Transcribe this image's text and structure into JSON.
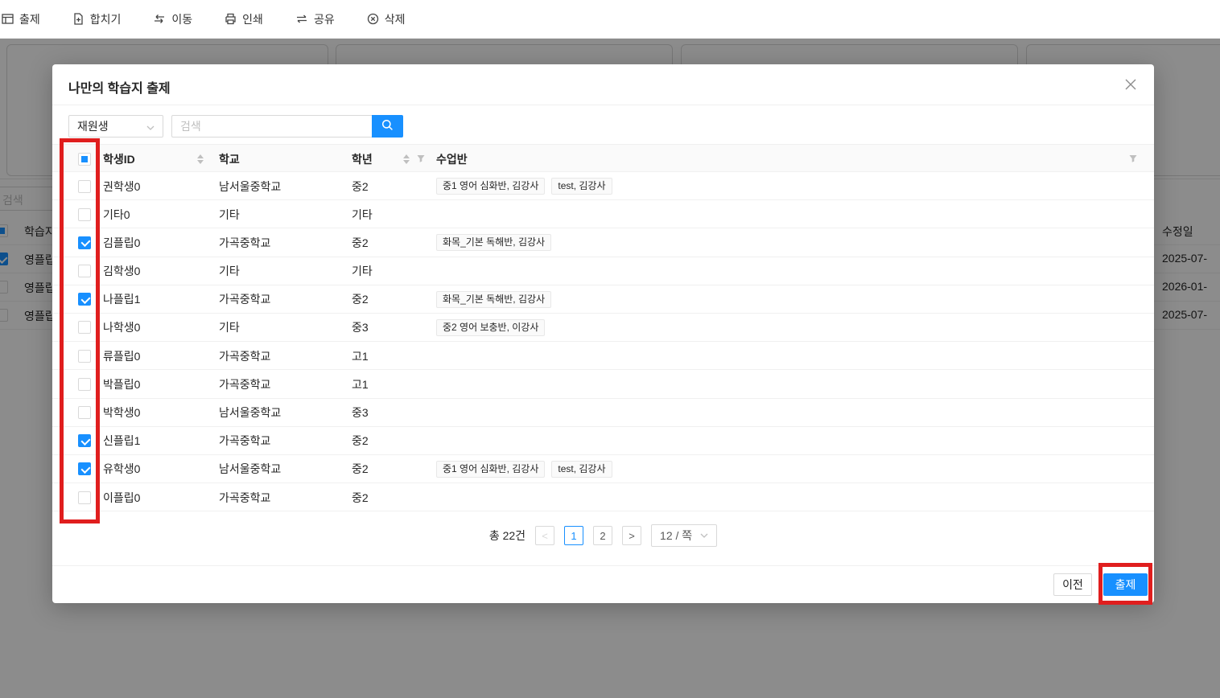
{
  "toolbar": {
    "items": [
      {
        "label": "출제",
        "icon": "worksheet-icon"
      },
      {
        "label": "합치기",
        "icon": "merge-file-icon"
      },
      {
        "label": "이동",
        "icon": "move-arrows-icon"
      },
      {
        "label": "인쇄",
        "icon": "printer-icon"
      },
      {
        "label": "공유",
        "icon": "share-icon"
      },
      {
        "label": "삭제",
        "icon": "delete-circle-icon"
      }
    ]
  },
  "background": {
    "search_placeholder": "검색",
    "table": {
      "header_left": "학습지",
      "header_right": "수정일",
      "rows": [
        {
          "title": "영플립",
          "date": "2025-07-",
          "checked": true
        },
        {
          "title": "영플립",
          "date": "2026-01-",
          "checked": false
        },
        {
          "title": "영플립",
          "date": "2025-07-",
          "checked": false
        }
      ]
    }
  },
  "modal": {
    "title": "나만의 학습지 출제",
    "filter_select_value": "재원생",
    "search_placeholder": "검색",
    "table": {
      "columns": {
        "student_id": "학생ID",
        "school": "학교",
        "grade": "학년",
        "class": "수업반"
      },
      "header_checkbox_state": "indeterminate",
      "rows": [
        {
          "checked": false,
          "id": "권학생0",
          "school": "남서울중학교",
          "grade": "중2",
          "classes": [
            "중1 영어 심화반, 김강사",
            "test, 김강사"
          ]
        },
        {
          "checked": false,
          "id": "기타0",
          "school": "기타",
          "grade": "기타",
          "classes": []
        },
        {
          "checked": true,
          "id": "김플립0",
          "school": "가곡중학교",
          "grade": "중2",
          "classes": [
            "화목_기본 독해반, 김강사"
          ]
        },
        {
          "checked": false,
          "id": "김학생0",
          "school": "기타",
          "grade": "기타",
          "classes": []
        },
        {
          "checked": true,
          "id": "나플립1",
          "school": "가곡중학교",
          "grade": "중2",
          "classes": [
            "화목_기본 독해반, 김강사"
          ]
        },
        {
          "checked": false,
          "id": "나학생0",
          "school": "기타",
          "grade": "중3",
          "classes": [
            "중2 영어 보충반, 이강사"
          ]
        },
        {
          "checked": false,
          "id": "류플립0",
          "school": "가곡중학교",
          "grade": "고1",
          "classes": []
        },
        {
          "checked": false,
          "id": "박플립0",
          "school": "가곡중학교",
          "grade": "고1",
          "classes": []
        },
        {
          "checked": false,
          "id": "박학생0",
          "school": "남서울중학교",
          "grade": "중3",
          "classes": []
        },
        {
          "checked": true,
          "id": "신플립1",
          "school": "가곡중학교",
          "grade": "중2",
          "classes": []
        },
        {
          "checked": true,
          "id": "유학생0",
          "school": "남서울중학교",
          "grade": "중2",
          "classes": [
            "중1 영어 심화반, 김강사",
            "test, 김강사"
          ]
        },
        {
          "checked": false,
          "id": "이플립0",
          "school": "가곡중학교",
          "grade": "중2",
          "classes": []
        }
      ]
    },
    "pagination": {
      "total_label": "총 22건",
      "pages": [
        {
          "label": "1",
          "active": true
        },
        {
          "label": "2",
          "active": false
        }
      ],
      "prev_icon": "chevron-left-icon",
      "next_icon": "chevron-right-icon",
      "page_size_label": "12 / 쪽"
    },
    "footer": {
      "prev_label": "이전",
      "submit_label": "출제"
    },
    "close_icon": "close-icon"
  },
  "colors": {
    "primary_blue": "#1890ff",
    "annotation_red": "#e01e1e",
    "overlay": "rgba(0,0,0,0.45)"
  }
}
